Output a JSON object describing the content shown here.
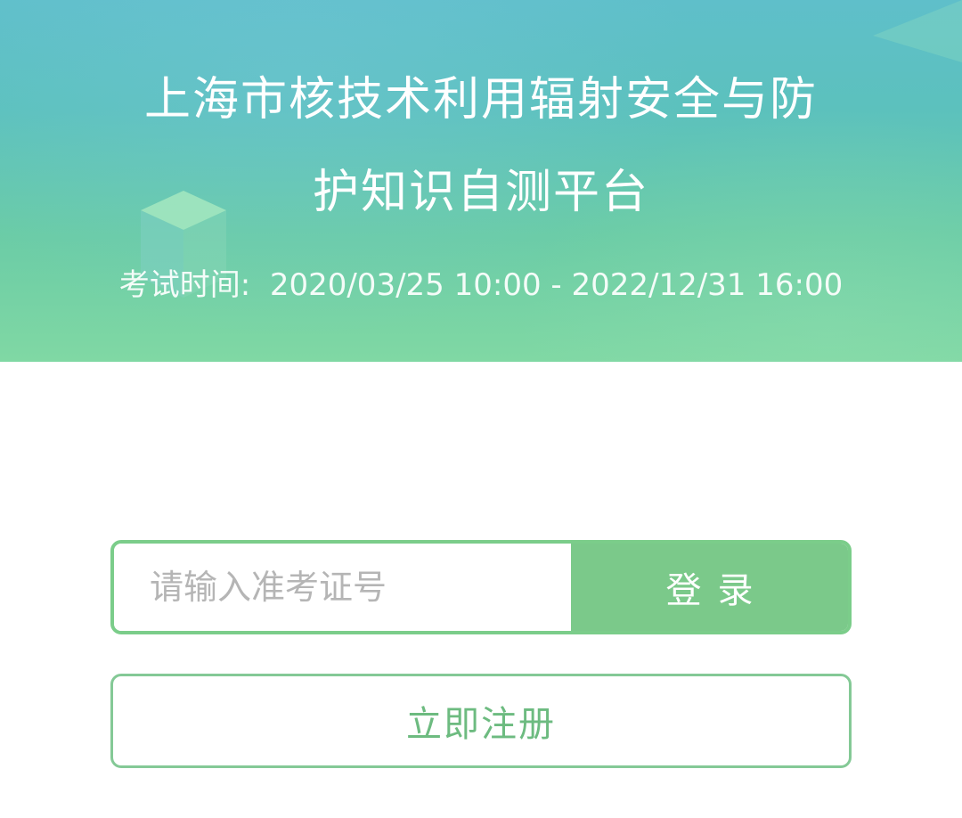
{
  "header": {
    "title_line1": "上海市核技术利用辐射安全与防",
    "title_line2": "护知识自测平台",
    "exam_time_label": "考试时间:",
    "exam_time_value": "2020/03/25 10:00 - 2022/12/31 16:00"
  },
  "login": {
    "input_placeholder": "请输入准考证号",
    "input_value": "",
    "login_label": "登录",
    "register_label": "立即注册"
  },
  "colors": {
    "primary_green": "#7bc98a",
    "banner_top": "#5fbfca",
    "banner_bottom": "#80d8a4"
  }
}
